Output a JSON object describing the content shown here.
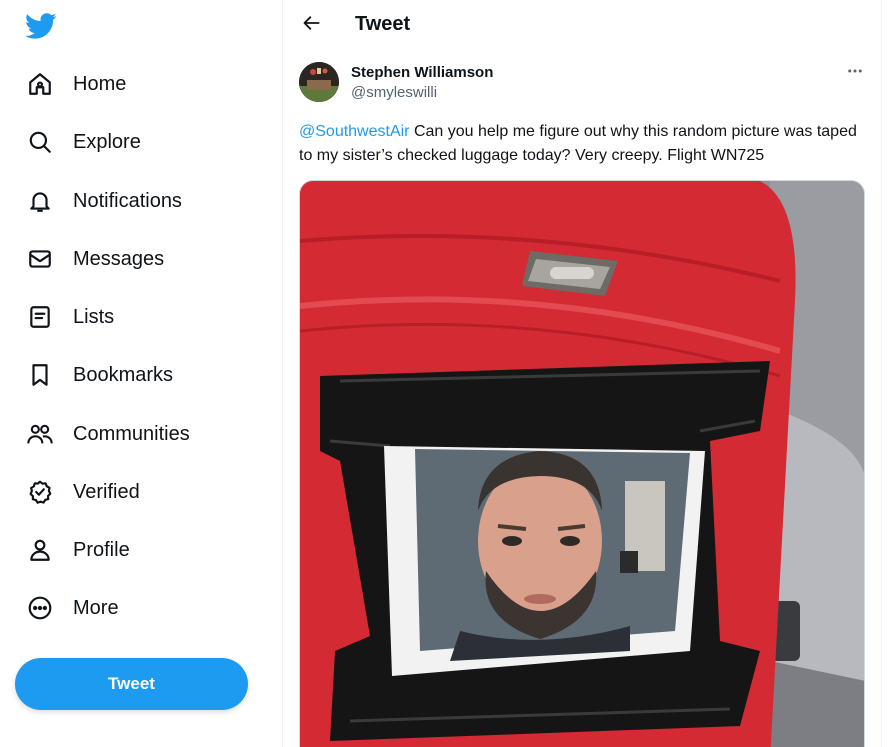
{
  "nav": {
    "items": [
      {
        "label": "Home",
        "icon": "home-icon"
      },
      {
        "label": "Explore",
        "icon": "search-icon"
      },
      {
        "label": "Notifications",
        "icon": "bell-icon"
      },
      {
        "label": "Messages",
        "icon": "envelope-icon"
      },
      {
        "label": "Lists",
        "icon": "list-icon"
      },
      {
        "label": "Bookmarks",
        "icon": "bookmark-icon"
      },
      {
        "label": "Communities",
        "icon": "people-icon"
      },
      {
        "label": "Verified",
        "icon": "verified-icon"
      },
      {
        "label": "Profile",
        "icon": "person-icon"
      },
      {
        "label": "More",
        "icon": "more-circle-icon"
      }
    ],
    "tweet_button": "Tweet"
  },
  "header": {
    "title": "Tweet"
  },
  "tweet": {
    "author_name": "Stephen Williamson",
    "author_handle": "@smyleswilli",
    "mention": "@SouthwestAir",
    "text": " Can you help me figure out why this random picture was taped to my sister’s checked luggage today? Very creepy. Flight WN725"
  },
  "colors": {
    "accent": "#1d9bf0",
    "text": "#0f1419",
    "muted": "#536471",
    "luggage": "#d42a34"
  }
}
